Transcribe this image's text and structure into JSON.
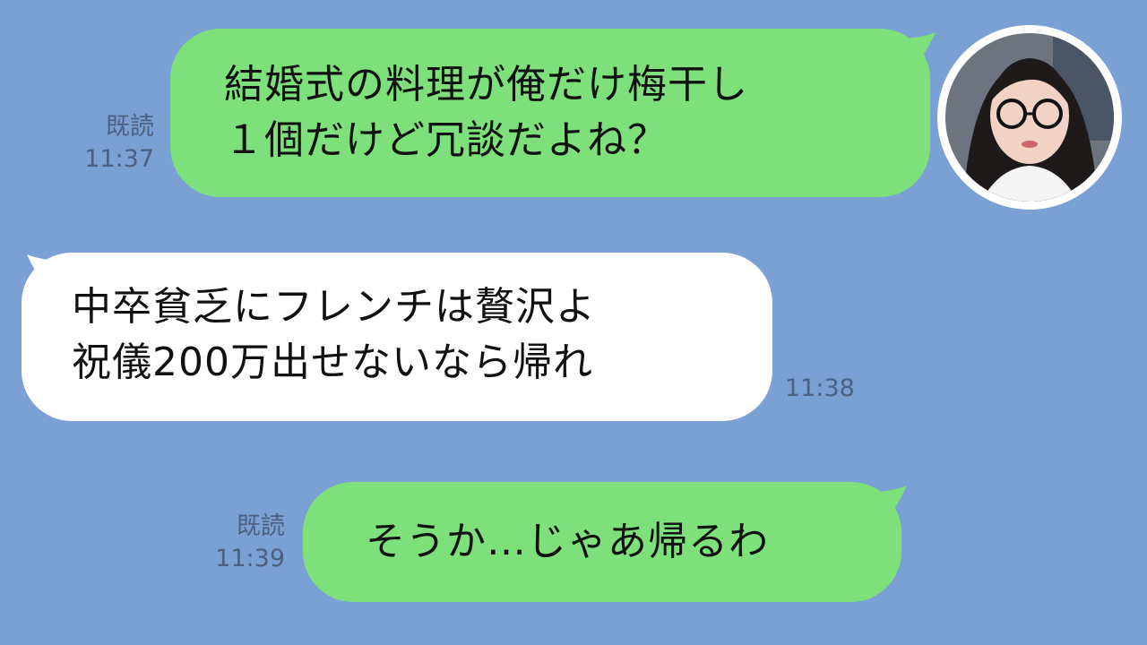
{
  "messages": [
    {
      "side": "mine",
      "lines": [
        "結婚式の料理が俺だけ梅干し",
        "１個だけど冗談だよね？"
      ],
      "read_label": "既読",
      "time": "11:37"
    },
    {
      "side": "theirs",
      "lines": [
        "中卒貧乏にフレンチは贅沢よ",
        "祝儀200万出せないなら帰れ"
      ],
      "time": "11:38"
    },
    {
      "side": "mine",
      "lines": [
        "そうか…じゃあ帰るわ"
      ],
      "read_label": "既読",
      "time": "11:39"
    }
  ],
  "avatar": {
    "icon": "user-avatar-photo"
  },
  "colors": {
    "background": "#7aa0d4",
    "my_bubble": "#7ee07a",
    "their_bubble": "#ffffff",
    "meta_text": "#4b5f80"
  }
}
